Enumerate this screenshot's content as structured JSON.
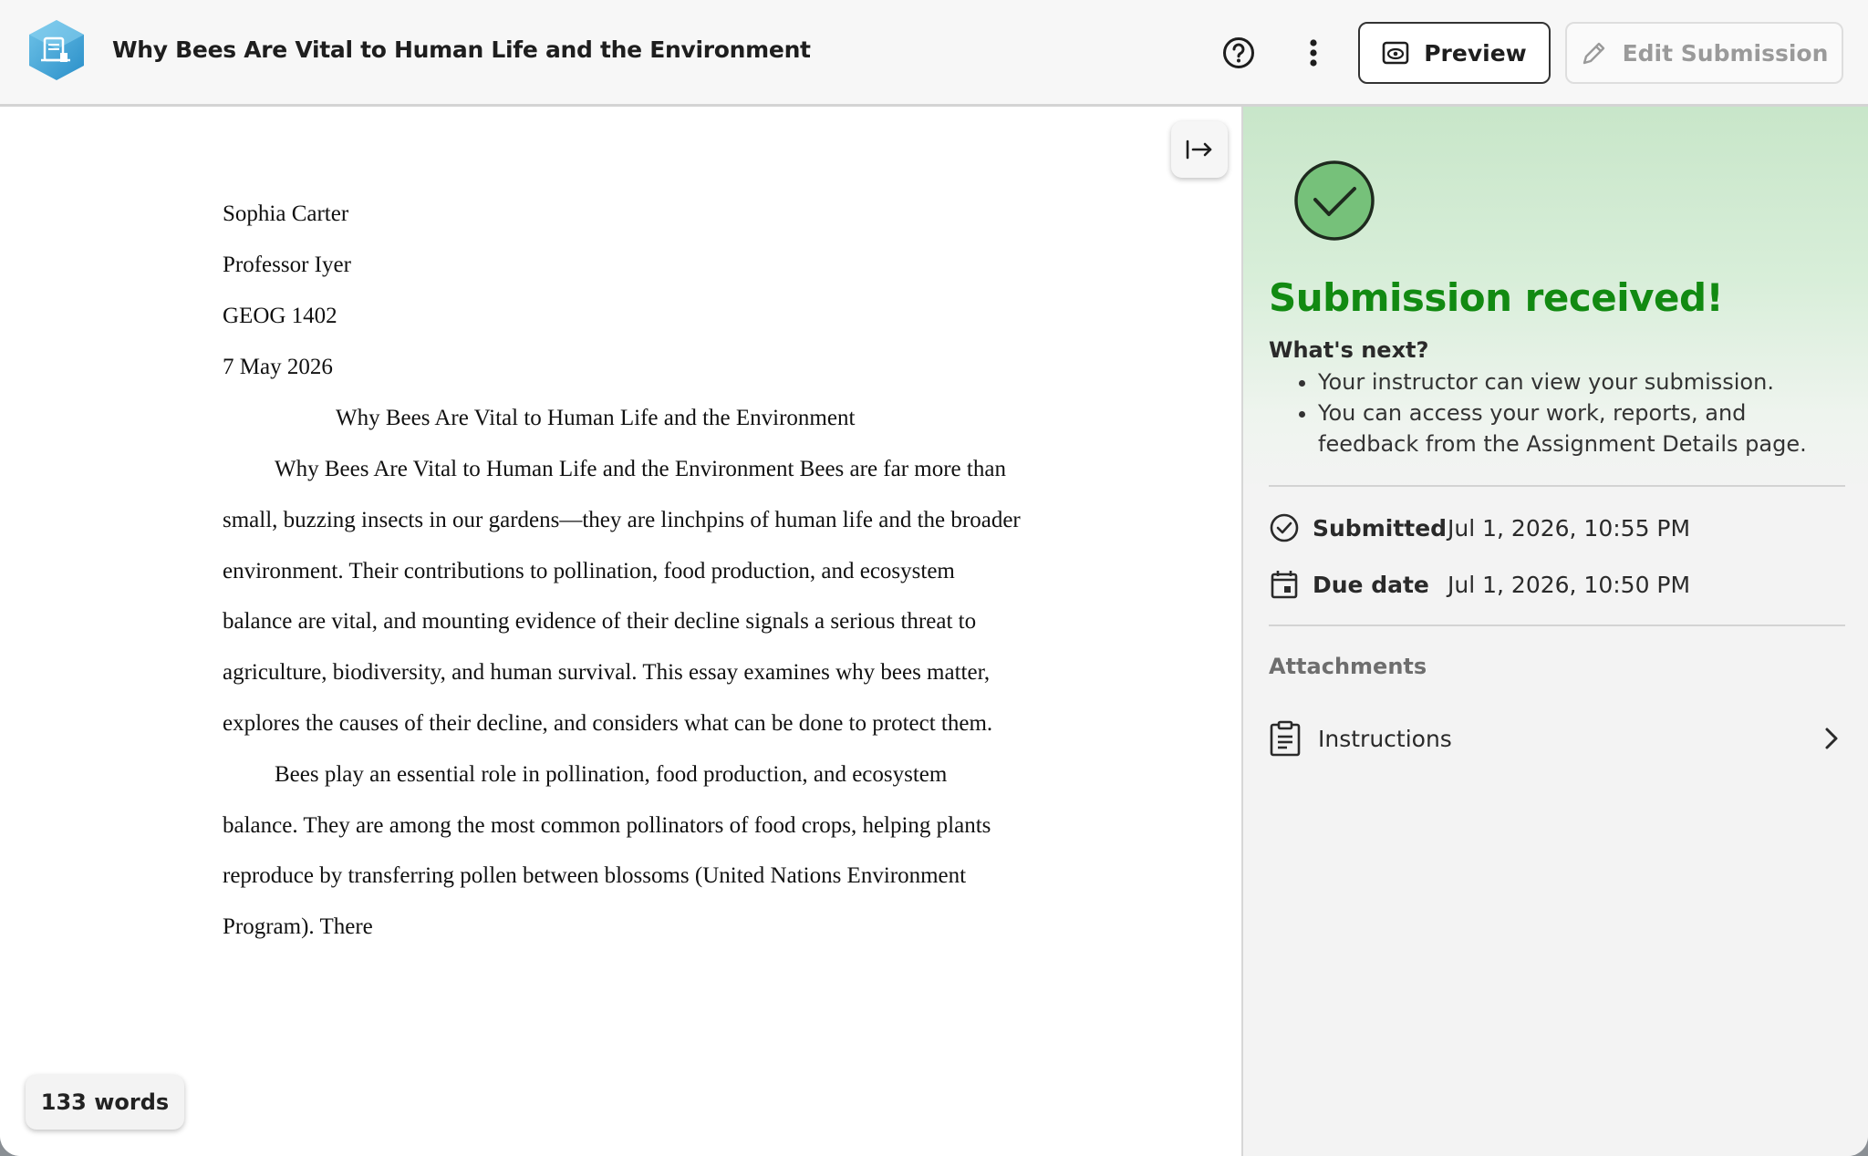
{
  "header": {
    "title": "Why Bees Are Vital to Human Life and the Environment",
    "help_icon": "help-circle-icon",
    "more_icon": "more-vertical-icon",
    "preview_label": "Preview",
    "edit_label": "Edit Submission"
  },
  "document": {
    "header_lines": [
      "Sophia Carter",
      "Professor Iyer",
      "GEOG 1402",
      "7 May 2026"
    ],
    "title": "Why Bees Are Vital to Human Life and the Environment",
    "paragraphs": [
      "Why Bees Are Vital to Human Life and the Environment Bees are far more than small, buzzing insects in our gardens—they are linchpins of human life and the broader environment. Their contributions to pollination, food production, and ecosystem balance are vital, and mounting evidence of their decline signals a serious threat to agriculture, biodiversity, and human survival. This essay examines why bees matter, explores the causes of their decline, and considers what can be done to protect them.",
      "Bees play an essential role in pollination, food production, and ecosystem balance. They are among the most common pollinators of food crops, helping plants reproduce by transferring pollen between blossoms (United Nations Environment Program). There"
    ],
    "word_count": "133 words"
  },
  "panel": {
    "status_title": "Submission received!",
    "next_label": "What's next?",
    "next_items": [
      "Your instructor can view your submission.",
      "You can access your work, reports, and feedback from the Assignment Details page."
    ],
    "submitted_label": "Submitted",
    "submitted_value": "Jul 1, 2026, 10:55 PM",
    "due_label": "Due date",
    "due_value": "Jul 1, 2026, 10:50 PM",
    "attachments_label": "Attachments",
    "attachments": [
      {
        "label": "Instructions",
        "icon": "clipboard-icon"
      }
    ]
  },
  "colors": {
    "success_green": "#128a12",
    "check_fill": "#76c17a",
    "panel_gradient_top": "#c8e6c9"
  }
}
